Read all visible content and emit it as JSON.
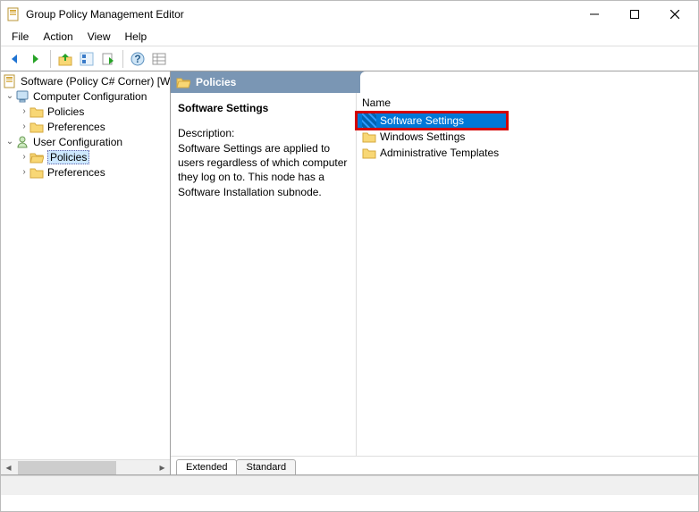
{
  "window": {
    "title": "Group Policy Management Editor"
  },
  "menu": {
    "file": "File",
    "action": "Action",
    "view": "View",
    "help": "Help"
  },
  "tree": {
    "root": "Software (Policy C# Corner) [WI",
    "computer": "Computer Configuration",
    "user": "User Configuration",
    "policies": "Policies",
    "preferences": "Preferences"
  },
  "header": {
    "title": "Policies"
  },
  "detail": {
    "heading": "Software Settings",
    "descLabel": "Description:",
    "descText": "Software Settings are applied to users regardless of which computer they log on to. This node has a Software Installation subnode."
  },
  "list": {
    "colName": "Name",
    "items": [
      {
        "label": "Software Settings",
        "selected": true,
        "highlight": true
      },
      {
        "label": "Windows Settings",
        "selected": false,
        "highlight": false
      },
      {
        "label": "Administrative Templates",
        "selected": false,
        "highlight": false
      }
    ]
  },
  "tabs": {
    "extended": "Extended",
    "standard": "Standard"
  }
}
